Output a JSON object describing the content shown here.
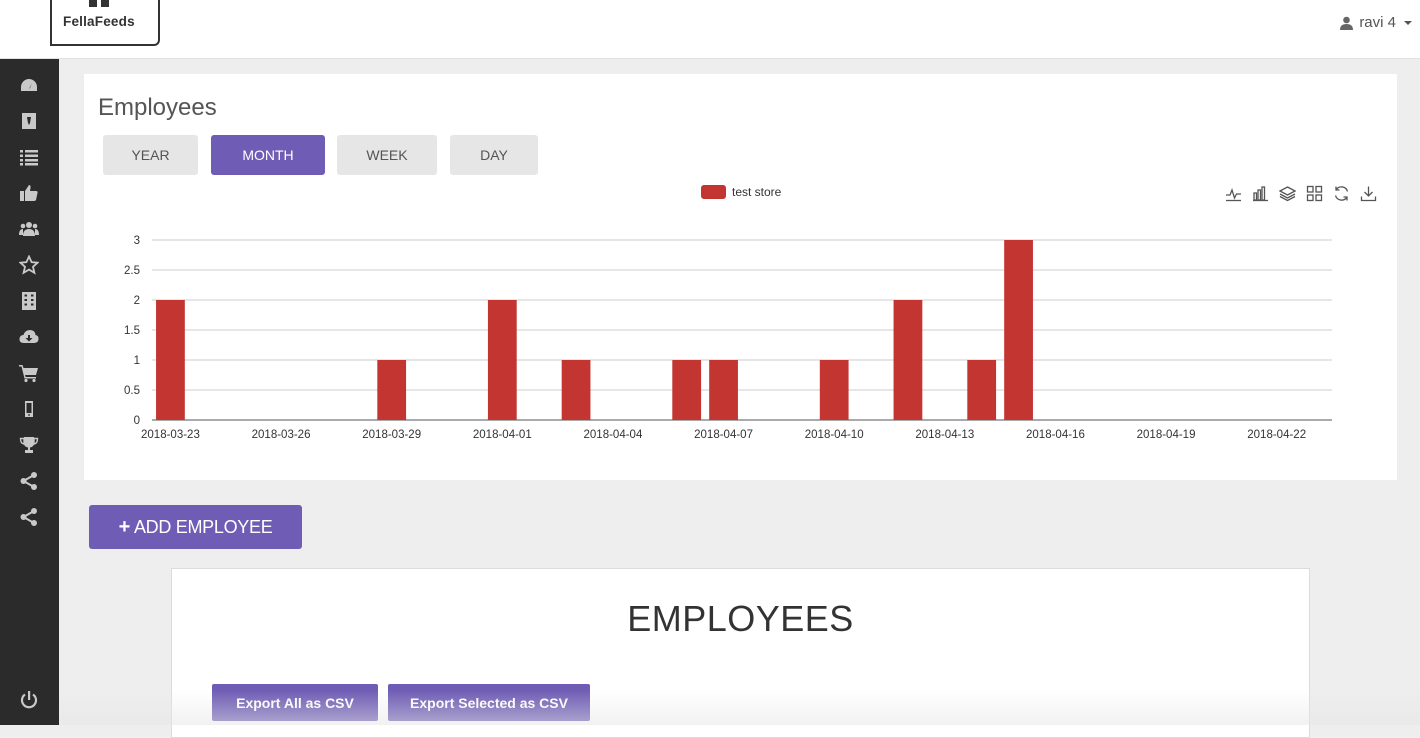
{
  "brand": {
    "name": "FellaFeeds"
  },
  "user": {
    "name": "ravi 4",
    "icon": "user-icon"
  },
  "sidebar": {
    "icons": [
      "dashboard-icon",
      "badge-icon",
      "list-icon",
      "thumbs-up-icon",
      "users-icon",
      "star-icon",
      "building-icon",
      "cloud-download-icon",
      "cart-icon",
      "mobile-icon",
      "trophy-icon",
      "share-icon",
      "share-icon"
    ],
    "footer_icon": "power-icon"
  },
  "chart_section": {
    "title": "Employees",
    "periods": [
      {
        "label": "YEAR",
        "active": false
      },
      {
        "label": "MONTH",
        "active": true
      },
      {
        "label": "WEEK",
        "active": false
      },
      {
        "label": "DAY",
        "active": false
      }
    ],
    "toolbox_icons": [
      "line-chart-icon",
      "bar-chart-icon",
      "stack-icon",
      "tiled-icon",
      "restore-icon",
      "download-icon"
    ]
  },
  "chart_data": {
    "type": "bar",
    "legend_position": "top-center",
    "grid": true,
    "series": [
      {
        "name": "test store",
        "color": "#c23531",
        "points": [
          {
            "x": "2018-03-23",
            "y": 2
          },
          {
            "x": "2018-03-29",
            "y": 1
          },
          {
            "x": "2018-04-01",
            "y": 2
          },
          {
            "x": "2018-04-03",
            "y": 1
          },
          {
            "x": "2018-04-06",
            "y": 1
          },
          {
            "x": "2018-04-07",
            "y": 1
          },
          {
            "x": "2018-04-10",
            "y": 1
          },
          {
            "x": "2018-04-12",
            "y": 2
          },
          {
            "x": "2018-04-14",
            "y": 1
          },
          {
            "x": "2018-04-15",
            "y": 3
          }
        ]
      }
    ],
    "x_ticks": [
      "2018-03-23",
      "2018-03-26",
      "2018-03-29",
      "2018-04-01",
      "2018-04-04",
      "2018-04-07",
      "2018-04-10",
      "2018-04-13",
      "2018-04-16",
      "2018-04-19",
      "2018-04-22"
    ],
    "x_range": [
      "2018-03-23",
      "2018-04-24"
    ],
    "y_ticks": [
      "0",
      "0.5",
      "1",
      "1.5",
      "2",
      "2.5",
      "3"
    ],
    "ylim": [
      0,
      3
    ]
  },
  "actions": {
    "add_employee": "ADD EMPLOYEE"
  },
  "employees_panel": {
    "title": "EMPLOYEES",
    "export_all": "Export All as CSV",
    "export_selected": "Export Selected as CSV"
  }
}
